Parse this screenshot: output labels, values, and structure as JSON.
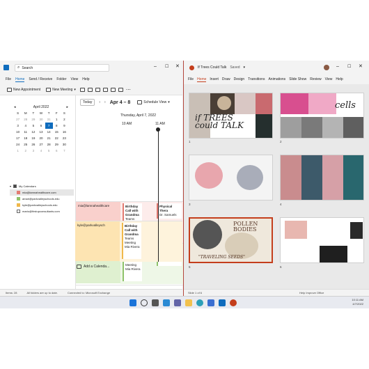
{
  "colors": {
    "outlook_accent": "#0f6cbd",
    "ppt_accent": "#c43e1c",
    "event_red": "#f9d0cc",
    "event_green": "#dff0d0",
    "event_yellow": "#fde4b2"
  },
  "outlook": {
    "search_placeholder": "Search",
    "menu": [
      "File",
      "Home",
      "Send / Receive",
      "Folder",
      "View",
      "Help"
    ],
    "ribbon": {
      "new_appointment": "New Appointment",
      "new_meeting": "New Meeting"
    },
    "mini_calendar": {
      "month_label": "April 2022",
      "weekdays": [
        "S",
        "M",
        "T",
        "W",
        "T",
        "F",
        "S"
      ],
      "weeks": [
        [
          "27",
          "28",
          "29",
          "30",
          "31",
          "1",
          "2"
        ],
        [
          "3",
          "4",
          "5",
          "6",
          "7",
          "8",
          "9"
        ],
        [
          "10",
          "11",
          "12",
          "13",
          "14",
          "15",
          "16"
        ],
        [
          "17",
          "18",
          "19",
          "20",
          "21",
          "22",
          "23"
        ],
        [
          "24",
          "25",
          "26",
          "27",
          "28",
          "29",
          "30"
        ],
        [
          "1",
          "2",
          "3",
          "4",
          "5",
          "6",
          "7"
        ]
      ],
      "selected_day": "7"
    },
    "my_calendars_label": "My Calendars",
    "calendars": [
      "mia@lamnahealthcare.com",
      "amari@parkvalleyschools.edu",
      "kyle@parkvalleyschools.edu",
      "mario@firstupconsultants.com"
    ],
    "today_button": "Today",
    "date_range": "Apr 4 – 8",
    "schedule_view": "Schedule View",
    "day_header": "Thursday, April 7, 2022",
    "times": [
      "10 AM",
      "11 AM"
    ],
    "rows": [
      {
        "owner": "mia@lamnahealthcare",
        "event1": {
          "title": "Birthday Call with Grandma",
          "sub": "Teams Meeting"
        },
        "event2": {
          "title": "Physical Thera",
          "sub": "Dr. Samuels"
        }
      },
      {
        "owner": "amari@parkvalleysc",
        "event1": {
          "title": "Birthday Call with Grandma",
          "sub": "Teams Meeting Mia Rivera"
        },
        "event2": {
          "title": "Virtual Museu",
          "sub": "Teams Meetin Monica Thom"
        }
      },
      {
        "owner": "kyle@parkvalleysch",
        "event1": {
          "title": "Birthday Call with Grandma",
          "sub": "Teams Meeting Mia Rivera"
        },
        "event2": {
          "title": "",
          "sub": ""
        }
      }
    ],
    "add_calendar": "Add a Calenda...",
    "status": {
      "items": "Items: 28",
      "folders": "All folders are up to date.",
      "connection": "Connected to: Microsoft Exchange"
    }
  },
  "powerpoint": {
    "title": "If Trees Could Talk",
    "saved": "Saved",
    "menu": [
      "File",
      "Home",
      "Insert",
      "Draw",
      "Design",
      "Transitions",
      "Animations",
      "Slide Show",
      "Review",
      "View",
      "Help"
    ],
    "slides": [
      {
        "number": "1",
        "text": "if TREES could TALK"
      },
      {
        "number": "2",
        "text": "cells"
      },
      {
        "number": "3",
        "text": ""
      },
      {
        "number": "4",
        "text": ""
      },
      {
        "number": "5",
        "text": "POLLEN BODIES",
        "caption": "\"TRAVELING SEEDS\""
      },
      {
        "number": "6",
        "text": ""
      }
    ],
    "status": {
      "slide": "Slide 1 of 6",
      "help": "Help Improve Office"
    }
  },
  "taskbar": {
    "time": "10:11 AM",
    "date": "4/7/2022"
  }
}
